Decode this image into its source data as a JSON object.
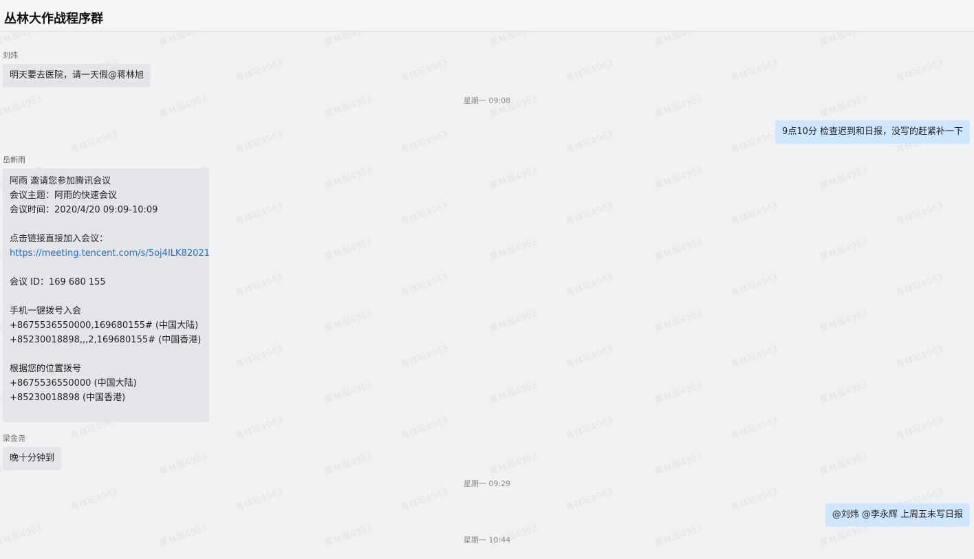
{
  "chat": {
    "title": "丛林大作战程序群"
  },
  "watermark": {
    "text": "蒋林旭4963"
  },
  "messages": {
    "m1": {
      "sender": "刘炜",
      "text": "明天要去医院，请一天假@蒋林旭"
    },
    "t1": "星期一 09:08",
    "m2": {
      "text": "9点10分 检查迟到和日报，没写的赶紧补一下"
    },
    "m3": {
      "sender": "岳新雨",
      "lines": [
        "阿雨 邀请您参加腾讯会议",
        "会议主题：阿雨的快速会议",
        "会议时间：2020/4/20 09:09-10:09",
        "",
        "点击链接直接加入会议：",
        "https://meeting.tencent.com/s/5oj4ILK82021",
        "",
        "会议 ID：169 680 155",
        "",
        "手机一键拨号入会",
        "+8675536550000,169680155# (中国大陆)",
        "+85230018898,,,2,169680155# (中国香港)",
        "",
        "根据您的位置拨号",
        "+8675536550000 (中国大陆)",
        "+85230018898 (中国香港)"
      ]
    },
    "m4": {
      "sender": "梁金尧",
      "text": "晚十分钟到"
    },
    "t2": "星期一 09:29",
    "m5": {
      "text": "@刘炜 @李永辉  上周五未写日报"
    },
    "t3": "星期一 10:44"
  },
  "colors": {
    "incoming_bubble": "#e3e5e8",
    "outgoing_bubble": "#cfe6ff",
    "link": "#1a6fd6"
  }
}
